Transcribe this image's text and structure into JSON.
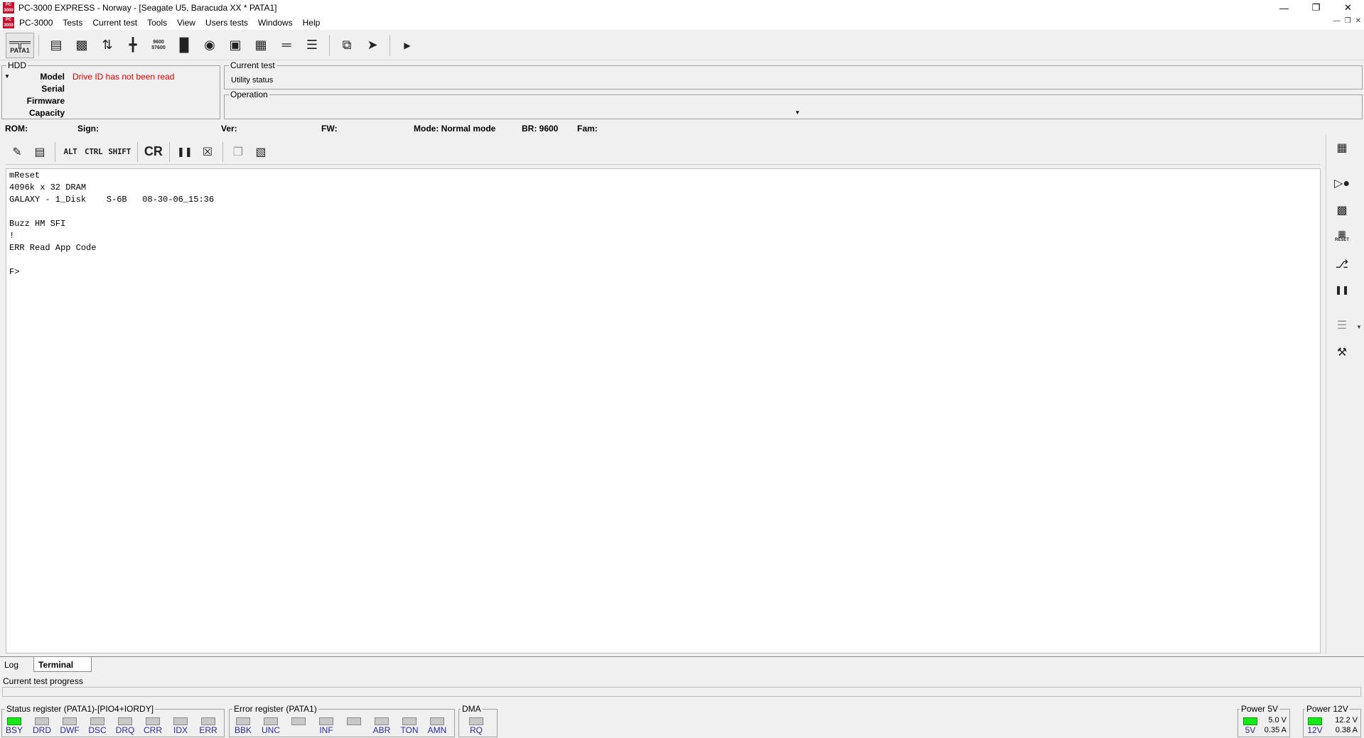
{
  "window": {
    "title": "PC-3000 EXPRESS - Norway - [Seagate U5, Baracuda XX * PATA1]",
    "logo_text": "PC 3000"
  },
  "menu": {
    "items": [
      "PC-3000",
      "Tests",
      "Current test",
      "Tools",
      "View",
      "Users tests",
      "Windows",
      "Help"
    ]
  },
  "toolbar": {
    "port_label": "PATA1",
    "icons": [
      "drive-id-icon",
      "drive-params-icon",
      "transfer-icon",
      "power-icon",
      "baud-rate-icon",
      "chip-icon",
      "disk-icon",
      "save-icon",
      "grid-icon",
      "bus-icon",
      "list-icon",
      "copy-windows-icon",
      "exit-icon",
      "play-icon"
    ],
    "baud_rate_icon_text": "9600 57600"
  },
  "hdd": {
    "group_label": "HDD",
    "fields": [
      {
        "label": "Model",
        "value": "Drive ID has not been read"
      },
      {
        "label": "Serial",
        "value": ""
      },
      {
        "label": "Firmware",
        "value": ""
      },
      {
        "label": "Capacity",
        "value": ""
      }
    ]
  },
  "current_test": {
    "group_label": "Current test",
    "status": "Utility status"
  },
  "operation": {
    "group_label": "Operation"
  },
  "info": {
    "rom": "ROM:",
    "sign": "Sign:",
    "ver": "Ver:",
    "fw": "FW:",
    "mode": "Mode: Normal mode",
    "br": "BR: 9600",
    "fam": "Fam:"
  },
  "terminal_toolbar": {
    "alt": "ALT",
    "ctrl": "CTRL",
    "shift": "SHIFT",
    "cr": "CR"
  },
  "terminal": {
    "lines": [
      "mReset",
      "4096k x 32 DRAM",
      "GALAXY - 1_Disk    S-6B   08-30-06_15:36",
      "",
      "Buzz HM SFI",
      "!",
      "ERR Read App Code",
      "",
      "F>"
    ]
  },
  "side_toolbar": {
    "reset_label": "RESET"
  },
  "tabs": [
    {
      "label": "Log",
      "active": false
    },
    {
      "label": "Terminal",
      "active": true
    }
  ],
  "progress": {
    "label": "Current test progress",
    "value": 0
  },
  "status_register": {
    "label": "Status register (PATA1)-[PIO4+IORDY]",
    "bits": [
      {
        "name": "BSY",
        "on": true
      },
      {
        "name": "DRD",
        "on": false
      },
      {
        "name": "DWF",
        "on": false
      },
      {
        "name": "DSC",
        "on": false
      },
      {
        "name": "DRQ",
        "on": false
      },
      {
        "name": "CRR",
        "on": false
      },
      {
        "name": "IDX",
        "on": false
      },
      {
        "name": "ERR",
        "on": false
      }
    ]
  },
  "error_register": {
    "label": "Error register (PATA1)",
    "bits": [
      {
        "name": "BBK",
        "on": false
      },
      {
        "name": "UNC",
        "on": false
      },
      {
        "name": "",
        "on": false
      },
      {
        "name": "INF",
        "on": false
      },
      {
        "name": "",
        "on": false
      },
      {
        "name": "ABR",
        "on": false
      },
      {
        "name": "TON",
        "on": false
      },
      {
        "name": "AMN",
        "on": false
      }
    ]
  },
  "dma": {
    "label": "DMA",
    "bits": [
      {
        "name": "RQ",
        "on": false
      }
    ]
  },
  "power5": {
    "label": "Power 5V",
    "led_label": "5V",
    "on": true,
    "voltage": "5.0 V",
    "current": "0.35 A"
  },
  "power12": {
    "label": "Power 12V",
    "led_label": "12V",
    "on": true,
    "voltage": "12.2 V",
    "current": "0.38 A"
  },
  "colors": {
    "led_on": "#17e61b",
    "led_off": "#c8c8c8",
    "error_text": "#e00000",
    "register_label": "#2a2a9a"
  }
}
